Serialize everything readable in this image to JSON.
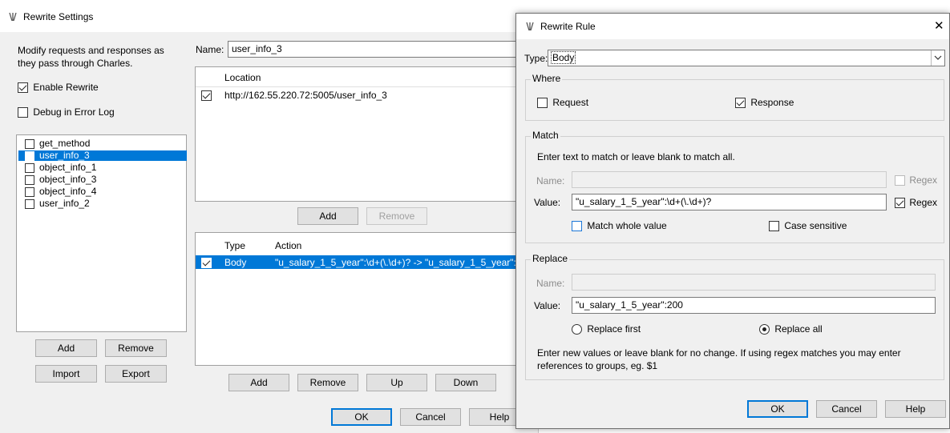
{
  "settings_window": {
    "title": "Rewrite Settings",
    "description": "Modify requests and responses as they pass through Charles.",
    "enable_rewrite_label": "Enable Rewrite",
    "enable_rewrite_checked": true,
    "debug_label": "Debug in Error Log",
    "debug_checked": false,
    "sets": [
      {
        "label": "get_method",
        "checked": false
      },
      {
        "label": "user_info_3",
        "checked": true,
        "selected": true
      },
      {
        "label": "object_info_1",
        "checked": false
      },
      {
        "label": "object_info_3",
        "checked": false
      },
      {
        "label": "object_info_4",
        "checked": false
      },
      {
        "label": "user_info_2",
        "checked": false
      }
    ],
    "set_buttons": {
      "add": "Add",
      "remove": "Remove",
      "import": "Import",
      "export": "Export"
    },
    "name_label": "Name:",
    "name_value": "user_info_3",
    "location_header": "Location",
    "locations": [
      {
        "checked": true,
        "url": "http://162.55.220.72:5005/user_info_3"
      }
    ],
    "location_buttons": {
      "add": "Add",
      "remove": "Remove"
    },
    "rules_headers": {
      "type": "Type",
      "action": "Action"
    },
    "rules": [
      {
        "checked": true,
        "type": "Body",
        "action": "\"u_salary_1_5_year\":\\d+(\\.\\d+)? -> \"u_salary_1_5_year\":"
      }
    ],
    "rule_buttons": {
      "add": "Add",
      "remove": "Remove",
      "up": "Up",
      "down": "Down"
    },
    "footer_buttons": {
      "ok": "OK",
      "cancel": "Cancel",
      "help": "Help"
    }
  },
  "rule_dialog": {
    "title": "Rewrite Rule",
    "close_glyph": "✕",
    "type_label": "Type:",
    "type_value": "Body",
    "where": {
      "title": "Where",
      "request_label": "Request",
      "request_checked": false,
      "response_label": "Response",
      "response_checked": true
    },
    "match": {
      "title": "Match",
      "hint": "Enter text to match or leave blank to match all.",
      "name_label": "Name:",
      "name_value": "",
      "name_regex_label": "Regex",
      "name_regex_checked": false,
      "value_label": "Value:",
      "value_value": "\"u_salary_1_5_year\":\\d+(\\.\\d+)?",
      "value_regex_label": "Regex",
      "value_regex_checked": true,
      "whole_label": "Match whole value",
      "whole_checked": false,
      "case_label": "Case sensitive",
      "case_checked": false
    },
    "replace": {
      "title": "Replace",
      "name_label": "Name:",
      "name_value": "",
      "value_label": "Value:",
      "value_value": "\"u_salary_1_5_year\":200",
      "first_label": "Replace first",
      "all_label": "Replace all",
      "selected": "all",
      "hint": "Enter new values or leave blank for no change. If using regex matches you may enter references to groups, eg. $1"
    },
    "buttons": {
      "ok": "OK",
      "cancel": "Cancel",
      "help": "Help"
    }
  }
}
